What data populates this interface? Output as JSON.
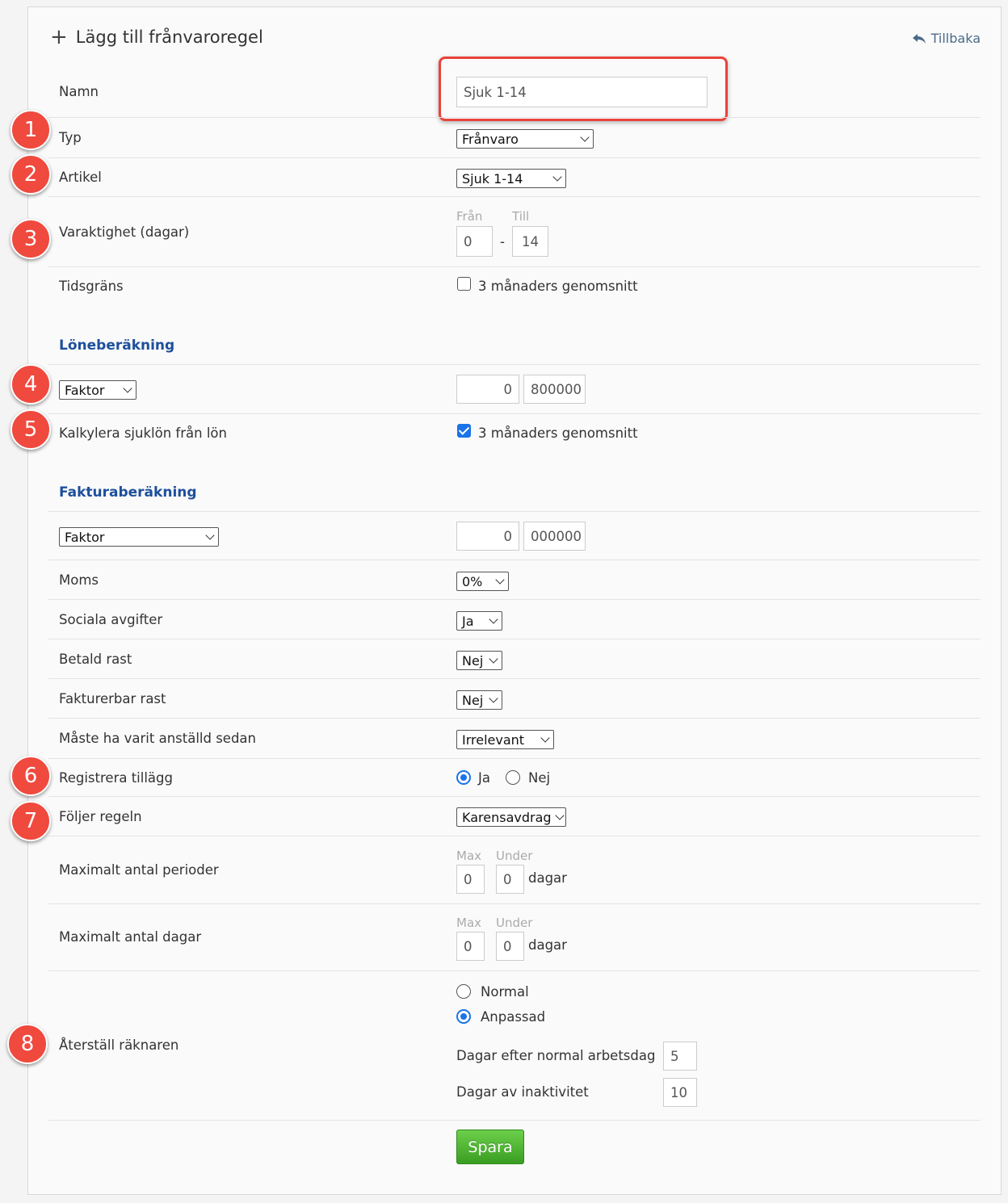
{
  "header": {
    "title": "Lägg till frånvaroregel",
    "back_label": "Tillbaka"
  },
  "fields": {
    "namn": {
      "label": "Namn",
      "value": "Sjuk 1-14"
    },
    "typ": {
      "label": "Typ",
      "value": "Frånvaro"
    },
    "artikel": {
      "label": "Artikel",
      "value": "Sjuk 1-14"
    },
    "varaktighet": {
      "label": "Varaktighet (dagar)",
      "from_label": "Från",
      "to_label": "Till",
      "from": "0",
      "sep": "-",
      "to": "14"
    },
    "tidsgrans": {
      "label": "Tidsgräns",
      "checkbox_label": "3 månaders genomsnitt",
      "checked": false
    }
  },
  "lone": {
    "section_title": "Löneberäkning",
    "faktor_select": "Faktor",
    "faktor_int": "0",
    "faktor_dec": "800000",
    "kalkylera_label": "Kalkylera sjuklön från lön",
    "kalkylera_checkbox_label": "3 månaders genomsnitt",
    "kalkylera_checked": true
  },
  "faktura": {
    "section_title": "Fakturaberäkning",
    "faktor_select": "Faktor",
    "faktor_int": "0",
    "faktor_dec": "000000",
    "moms": {
      "label": "Moms",
      "value": "0%"
    },
    "sociala": {
      "label": "Sociala avgifter",
      "value": "Ja"
    },
    "betald_rast": {
      "label": "Betald rast",
      "value": "Nej"
    },
    "fakturerbar_rast": {
      "label": "Fakturerbar rast",
      "value": "Nej"
    },
    "anstalld": {
      "label": "Måste ha varit anställd sedan",
      "value": "Irrelevant"
    },
    "registrera": {
      "label": "Registrera tillägg",
      "opt_ja": "Ja",
      "opt_nej": "Nej",
      "selected": "Ja"
    },
    "foljer": {
      "label": "Följer regeln",
      "value": "Karensavdrag"
    },
    "max_perioder": {
      "label": "Maximalt antal perioder",
      "max_label": "Max",
      "under_label": "Under",
      "max": "0",
      "under": "0",
      "unit": "dagar"
    },
    "max_dagar": {
      "label": "Maximalt antal dagar",
      "max_label": "Max",
      "under_label": "Under",
      "max": "0",
      "under": "0",
      "unit": "dagar"
    },
    "aterstall": {
      "label": "Återställ räknaren",
      "opt_normal": "Normal",
      "opt_anpassad": "Anpassad",
      "selected": "Anpassad",
      "dagar_efter_label": "Dagar efter normal arbetsdag",
      "dagar_efter": "5",
      "dagar_inaktiv_label": "Dagar av inaktivitet",
      "dagar_inaktiv": "10"
    }
  },
  "save_label": "Spara",
  "badges": [
    "1",
    "2",
    "3",
    "4",
    "5",
    "6",
    "7",
    "8"
  ],
  "colors": {
    "accent": "#1a73e8",
    "section": "#1d4f9c",
    "badge": "#f0493e",
    "save": "#4caf2f"
  }
}
